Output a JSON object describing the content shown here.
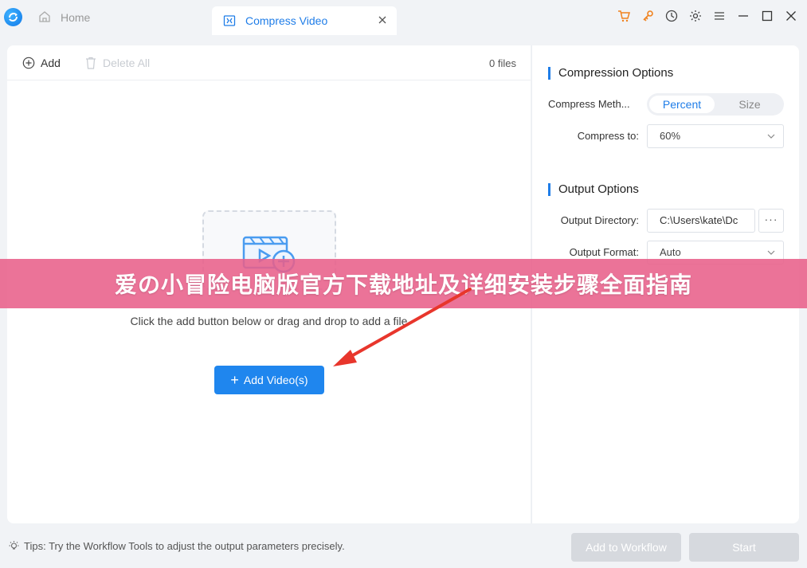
{
  "titlebar": {
    "home_tab": "Home",
    "active_tab": "Compress Video",
    "icons": [
      "cart-icon",
      "key-icon",
      "clock-icon",
      "gear-icon",
      "menu-icon",
      "minimize-icon",
      "maximize-icon",
      "close-icon"
    ]
  },
  "toolbar": {
    "add_label": "Add",
    "delete_all_label": "Delete All",
    "file_count": "0 files"
  },
  "drop_area": {
    "hint": "Click the add button below or drag and drop to add a file",
    "add_button": "Add Video(s)"
  },
  "compression": {
    "section_title": "Compression Options",
    "method_label": "Compress Meth...",
    "method_options": [
      "Percent",
      "Size"
    ],
    "method_selected": "Percent",
    "compress_to_label": "Compress to:",
    "compress_to_value": "60%"
  },
  "output": {
    "section_title": "Output Options",
    "directory_label": "Output Directory:",
    "directory_value": "C:\\Users\\kate\\Dc",
    "more_button": "···",
    "format_label": "Output Format:",
    "format_value": "Auto"
  },
  "banner": {
    "text": "爱の小冒险电脑版官方下载地址及详细安装步骤全面指南"
  },
  "footer": {
    "tips": "Tips: Try the Workflow Tools to adjust the output parameters precisely.",
    "workflow_button": "Add to Workflow",
    "start_button": "Start"
  },
  "colors": {
    "accent": "#1f86ee",
    "banner": "#e8608a",
    "disabled_button": "#d6d9de"
  }
}
